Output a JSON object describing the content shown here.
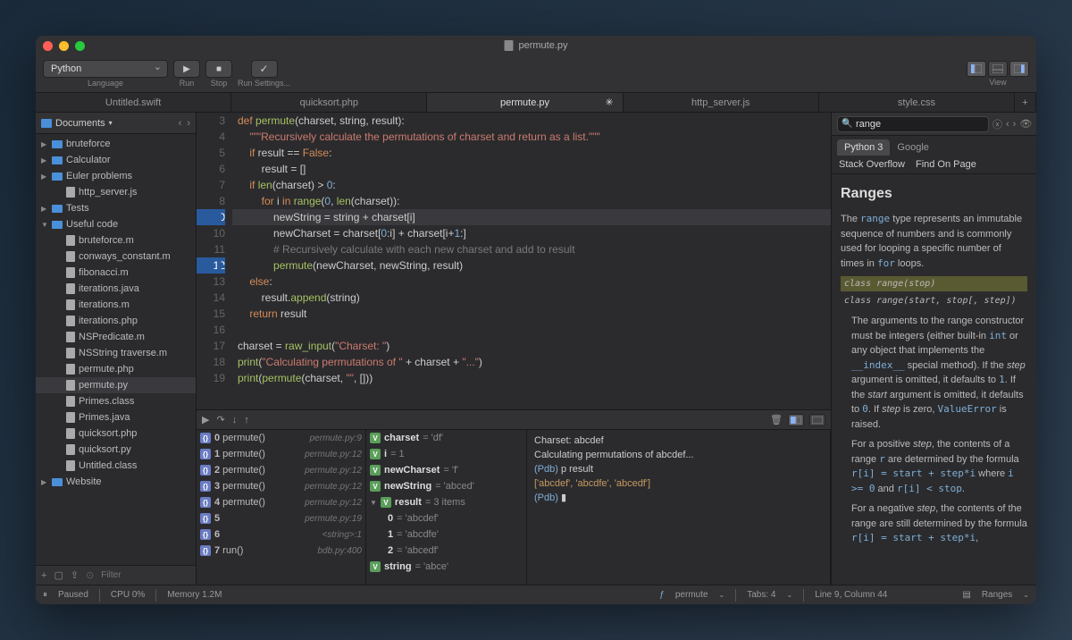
{
  "title": "permute.py",
  "toolbar": {
    "language": {
      "label": "Language",
      "value": "Python"
    },
    "run": {
      "label": "Run"
    },
    "stop": {
      "label": "Stop"
    },
    "settings": {
      "label": "Run Settings..."
    },
    "view": {
      "label": "View"
    }
  },
  "tabs": [
    {
      "label": "Untitled.swift"
    },
    {
      "label": "quicksort.php"
    },
    {
      "label": "permute.py",
      "active": true,
      "loading": true
    },
    {
      "label": "http_server.js"
    },
    {
      "label": "style.css"
    }
  ],
  "sidebar": {
    "root": "Documents",
    "items": [
      {
        "type": "folder",
        "label": "bruteforce",
        "open": false,
        "depth": 0
      },
      {
        "type": "folder",
        "label": "Calculator",
        "open": false,
        "depth": 0
      },
      {
        "type": "folder",
        "label": "Euler problems",
        "open": false,
        "depth": 0
      },
      {
        "type": "file",
        "label": "http_server.js",
        "depth": 1
      },
      {
        "type": "folder",
        "label": "Tests",
        "open": false,
        "depth": 0
      },
      {
        "type": "folder",
        "label": "Useful code",
        "open": true,
        "depth": 0
      },
      {
        "type": "file",
        "label": "bruteforce.m",
        "depth": 1
      },
      {
        "type": "file",
        "label": "conways_constant.m",
        "depth": 1
      },
      {
        "type": "file",
        "label": "fibonacci.m",
        "depth": 1
      },
      {
        "type": "file",
        "label": "iterations.java",
        "depth": 1
      },
      {
        "type": "file",
        "label": "iterations.m",
        "depth": 1
      },
      {
        "type": "file",
        "label": "iterations.php",
        "depth": 1
      },
      {
        "type": "file",
        "label": "NSPredicate.m",
        "depth": 1
      },
      {
        "type": "file",
        "label": "NSString traverse.m",
        "depth": 1
      },
      {
        "type": "file",
        "label": "permute.php",
        "depth": 1
      },
      {
        "type": "file",
        "label": "permute.py",
        "depth": 1,
        "selected": true
      },
      {
        "type": "file",
        "label": "Primes.class",
        "depth": 1
      },
      {
        "type": "file",
        "label": "Primes.java",
        "depth": 1
      },
      {
        "type": "file",
        "label": "quicksort.php",
        "depth": 1
      },
      {
        "type": "file",
        "label": "quicksort.py",
        "depth": 1
      },
      {
        "type": "file",
        "label": "Untitled.class",
        "depth": 1
      },
      {
        "type": "folder",
        "label": "Website",
        "open": false,
        "depth": 0
      }
    ],
    "filter_placeholder": "Filter"
  },
  "editor": {
    "lines": [
      {
        "n": 3,
        "html": "<span class='kw'>def</span> <span class='fn'>permute</span>(charset, string, result):"
      },
      {
        "n": 4,
        "html": "    <span class='str'>\"\"\"Recursively calculate the permutations of charset and return as a list.\"\"\"</span>"
      },
      {
        "n": 5,
        "html": "    <span class='kw'>if</span> result == <span class='kw'>False</span>:"
      },
      {
        "n": 6,
        "html": "        result = []"
      },
      {
        "n": 7,
        "html": "    <span class='kw'>if</span> <span class='fn'>len</span>(charset) &gt; <span class='num'>0</span>:"
      },
      {
        "n": 8,
        "html": "        <span class='kw'>for</span> i <span class='kw'>in</span> <span class='fn'>range</span>(<span class='num'>0</span>, <span class='fn'>len</span>(charset)):"
      },
      {
        "n": 9,
        "html": "            newString = string + charset[i]",
        "hl": true,
        "bp": true
      },
      {
        "n": 10,
        "html": "            newCharset = charset[<span class='num'>0</span>:i] + charset[i+<span class='num'>1</span>:]"
      },
      {
        "n": 11,
        "html": "            <span class='cm'># Recursively calculate with each new charset and add to result</span>"
      },
      {
        "n": 12,
        "html": "            <span class='fn'>permute</span>(newCharset, newString, result)",
        "bp": true
      },
      {
        "n": 13,
        "html": "    <span class='kw'>else</span>:"
      },
      {
        "n": 14,
        "html": "        result.<span class='fn'>append</span>(string)"
      },
      {
        "n": 15,
        "html": "    <span class='kw'>return</span> result"
      },
      {
        "n": 16,
        "html": ""
      },
      {
        "n": 17,
        "html": "charset = <span class='fn'>raw_input</span>(<span class='str'>\"Charset: \"</span>)"
      },
      {
        "n": 18,
        "html": "<span class='fn'>print</span>(<span class='str'>\"Calculating permutations of \"</span> + charset + <span class='str'>\"...\"</span>)"
      },
      {
        "n": 19,
        "html": "<span class='fn'>print</span>(<span class='fn'>permute</span>(charset, <span class='str'>\"\"</span>, []))"
      }
    ]
  },
  "debug": {
    "stack": [
      {
        "n": "0",
        "fn": "permute()",
        "loc": "permute.py:9"
      },
      {
        "n": "1",
        "fn": "permute()",
        "loc": "permute.py:12"
      },
      {
        "n": "2",
        "fn": "permute()",
        "loc": "permute.py:12"
      },
      {
        "n": "3",
        "fn": "permute()",
        "loc": "permute.py:12"
      },
      {
        "n": "4",
        "fn": "permute()",
        "loc": "permute.py:12"
      },
      {
        "n": "5",
        "fn": "",
        "loc": "permute.py:19"
      },
      {
        "n": "6",
        "fn": "",
        "loc": "<string>:1"
      },
      {
        "n": "7",
        "fn": "run()",
        "loc": "bdb.py:400"
      }
    ],
    "vars": [
      {
        "badge": "V",
        "name": "charset",
        "val": "= 'df'"
      },
      {
        "badge": "V",
        "name": "i",
        "val": "= 1"
      },
      {
        "badge": "V",
        "name": "newCharset",
        "val": "= 'f'"
      },
      {
        "badge": "V",
        "name": "newString",
        "val": "= 'abced'"
      },
      {
        "badge": "V",
        "name": "result",
        "val": "= 3 items",
        "expand": true
      },
      {
        "name": "0",
        "val": "= 'abcdef'",
        "indent": true
      },
      {
        "name": "1",
        "val": "= 'abcdfe'",
        "indent": true
      },
      {
        "name": "2",
        "val": "= 'abcedf'",
        "indent": true
      },
      {
        "badge": "V",
        "name": "string",
        "val": "= 'abce'"
      }
    ],
    "console": [
      {
        "text": "Charset: abcdef"
      },
      {
        "text": "Calculating permutations of abcdef..."
      },
      {
        "prompt": "(Pdb) ",
        "text": "p result"
      },
      {
        "result": "['abcdef', 'abcdfe', 'abcedf']"
      },
      {
        "prompt": "(Pdb) ",
        "cursor": true
      }
    ]
  },
  "rightPanel": {
    "search": "range",
    "sourceTabs": [
      "Python 3",
      "Google"
    ],
    "sourceTabs2": [
      "Stack Overflow",
      "Find On Page"
    ],
    "doc": {
      "title": "Ranges",
      "intro_pre": "The ",
      "intro_code1": "range",
      "intro_mid": " type represents an immutable sequence of numbers and is commonly used for looping a specific number of times in ",
      "intro_code2": "for",
      "intro_post": " loops.",
      "sig1": "class range(stop)",
      "sig2": "class range(start, stop[, step])",
      "p1": "The arguments to the range constructor must be integers (either built-in int or any object that implements the __index__ special method). If the step argument is omitted, it defaults to 1. If the start argument is omitted, it defaults to 0. If step is zero, ValueError is raised.",
      "p2": "For a positive step, the contents of a range r are determined by the formula r[i] = start + step*i where i >= 0 and r[i] < stop.",
      "p3": "For a negative step, the contents of the range are still determined by the formula r[i] = start + step*i,"
    }
  },
  "status": {
    "paused": "Paused",
    "cpu": "CPU 0%",
    "memory": "Memory 1.2M",
    "function": "permute",
    "tabs": "Tabs: 4",
    "cursor": "Line 9, Column 44",
    "docpanel": "Ranges"
  }
}
